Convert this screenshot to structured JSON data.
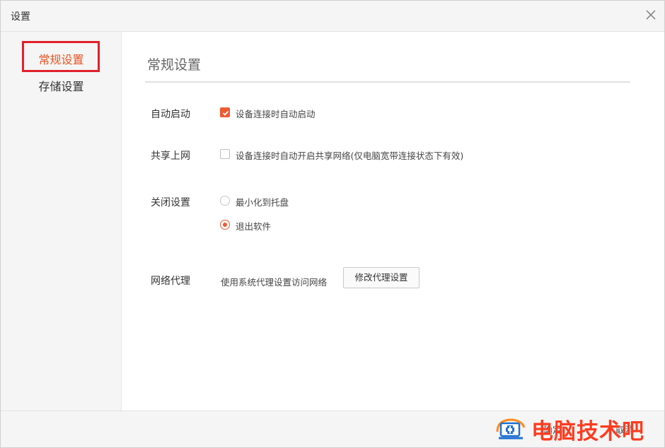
{
  "window": {
    "title": "设置",
    "close_icon": "close-icon"
  },
  "sidebar": {
    "items": [
      {
        "label": "常规设置",
        "active": true
      },
      {
        "label": "存储设置",
        "active": false
      }
    ],
    "highlight_color": "#e0202a"
  },
  "main": {
    "section_title": "常规设置",
    "auto_start": {
      "label": "自动启动",
      "option": "设备连接时自动启动",
      "checked": true
    },
    "share_internet": {
      "label": "共享上网",
      "option": "设备连接时自动开启共享网络(仅电脑宽带连接状态下有效)",
      "checked": false
    },
    "close_settings": {
      "label": "关闭设置",
      "options": [
        {
          "label": "最小化到托盘",
          "selected": false
        },
        {
          "label": "退出软件",
          "selected": true
        }
      ]
    },
    "proxy": {
      "label": "网络代理",
      "description": "使用系统代理设置访问网络",
      "button_label": "修改代理设置"
    }
  },
  "footer": {
    "confirm_label": "确定",
    "cancel_label": "取消"
  },
  "watermark": {
    "text": "电脑技术吧",
    "icon": "monitor-plus-icon"
  },
  "colors": {
    "accent": "#ee5a34",
    "active_nav": "#e8531e",
    "watermark": "#ff3b1f"
  }
}
